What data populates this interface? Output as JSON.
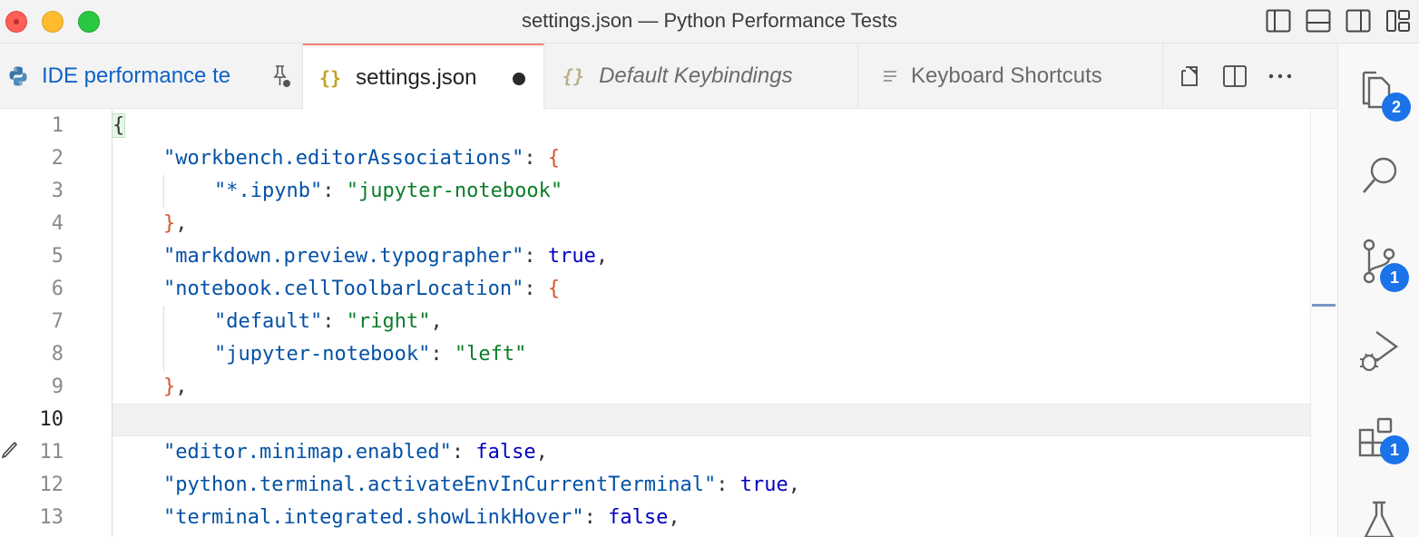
{
  "window": {
    "title": "settings.json — Python Performance Tests"
  },
  "tabs": [
    {
      "label": "IDE performance te",
      "icon": "python-icon",
      "state": "pinned"
    },
    {
      "label": "settings.json",
      "icon": "json-braces-icon",
      "state": "active-dirty"
    },
    {
      "label": "Default Keybindings",
      "icon": "json-braces-icon",
      "state": "preview"
    },
    {
      "label": "Keyboard Shortcuts",
      "icon": "list-icon",
      "state": "normal"
    }
  ],
  "tab_actions": [
    "open-changes-icon",
    "split-editor-icon",
    "more-actions-icon"
  ],
  "activity_bar": [
    {
      "name": "explorer-icon",
      "badge": "2"
    },
    {
      "name": "search-icon",
      "badge": ""
    },
    {
      "name": "source-control-icon",
      "badge": "1"
    },
    {
      "name": "run-debug-icon",
      "badge": ""
    },
    {
      "name": "extensions-icon",
      "badge": "1"
    },
    {
      "name": "testing-icon",
      "badge": ""
    }
  ],
  "editor": {
    "active_line": "10",
    "line_numbers": [
      "1",
      "2",
      "3",
      "4",
      "5",
      "6",
      "7",
      "8",
      "9",
      "10",
      "11",
      "12",
      "13"
    ],
    "lines": {
      "l1_brace": "{",
      "l2_key": "\"workbench.editorAssociations\"",
      "l2_rest": ": ",
      "l2_brace": "{",
      "l3_key": "\"*.ipynb\"",
      "l3_colon": ": ",
      "l3_value": "\"jupyter-notebook\"",
      "l4_brace": "}",
      "l4_comma": ",",
      "l5_key": "\"markdown.preview.typographer\"",
      "l5_colon": ": ",
      "l5_value": "true",
      "l5_comma": ",",
      "l6_key": "\"notebook.cellToolbarLocation\"",
      "l6_colon": ": ",
      "l6_brace": "{",
      "l7_key": "\"default\"",
      "l7_colon": ": ",
      "l7_value": "\"right\"",
      "l7_comma": ",",
      "l8_key": "\"jupyter-notebook\"",
      "l8_colon": ": ",
      "l8_value": "\"left\"",
      "l9_brace": "}",
      "l9_comma": ",",
      "l11_key": "\"editor.minimap.enabled\"",
      "l11_colon": ": ",
      "l11_value": "false",
      "l11_comma": ",",
      "l12_key": "\"python.terminal.activateEnvInCurrentTerminal\"",
      "l12_colon": ": ",
      "l12_value": "true",
      "l12_comma": ",",
      "l13_key": "\"terminal.integrated.showLinkHover\"",
      "l13_colon": ": ",
      "l13_value": "false",
      "l13_comma": ","
    }
  },
  "colors": {
    "json_key": "#0451a5",
    "json_string": "#0a7d2a",
    "json_literal": "#0000c0",
    "bracket": "#d3542b",
    "badge": "#1a73e8",
    "active_tab_border": "#f0837a"
  }
}
